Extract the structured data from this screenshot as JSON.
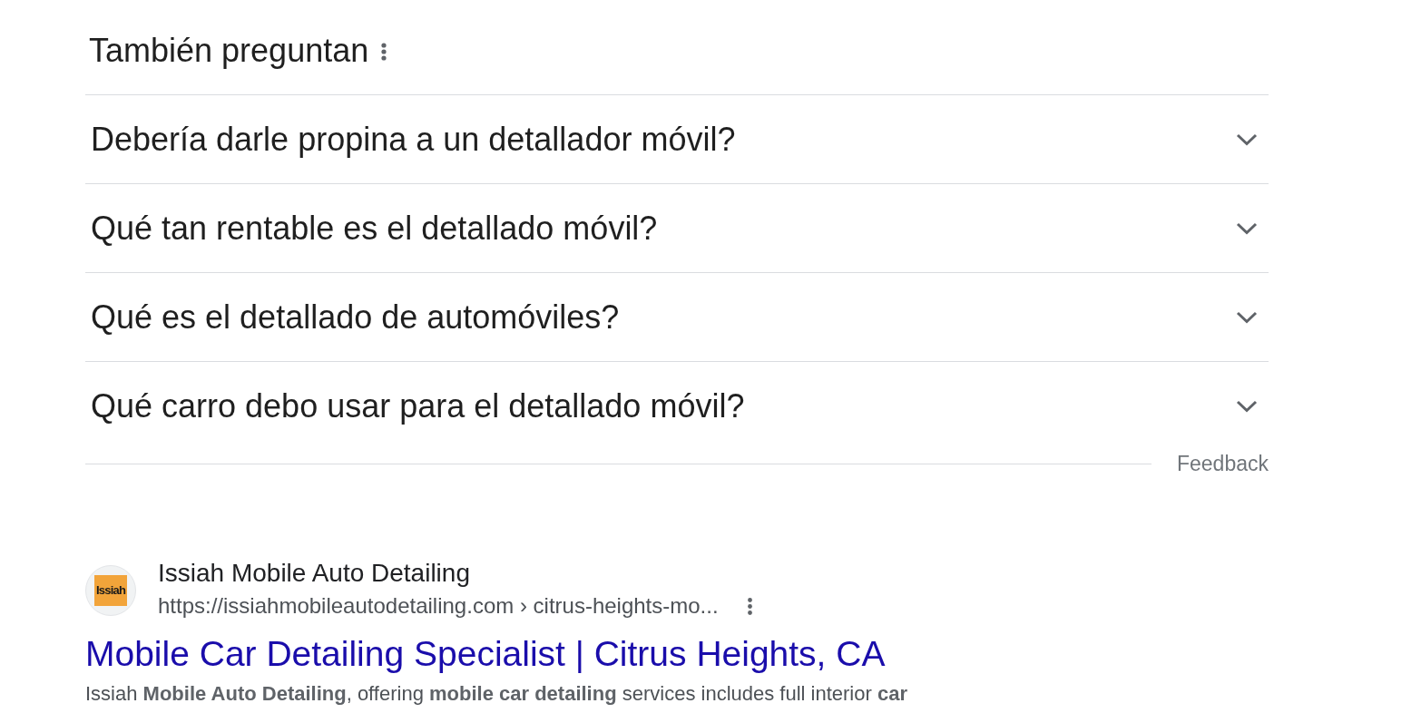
{
  "section": {
    "title": "También preguntan",
    "questions": [
      {
        "text": "Debería darle propina a un detallador móvil?",
        "expanded": false
      },
      {
        "text": "Qué tan rentable es el detallado móvil?",
        "expanded": false
      },
      {
        "text": "Qué es el detallado de automóviles?",
        "expanded": false
      },
      {
        "text": "Qué carro debo usar para el detallado móvil?",
        "expanded": false
      }
    ],
    "feedback": "Feedback"
  },
  "result": {
    "favicon_text": "Issiah",
    "site_name": "Issiah Mobile Auto Detailing",
    "url": "https://issiahmobileautodetailing.com › citrus-heights-mo...",
    "title": "Mobile Car Detailing Specialist | Citrus Heights, CA",
    "snippet": "Issiah **Mobile Auto Detailing**, offering **mobile car detailing** services includes full interior **car**"
  }
}
